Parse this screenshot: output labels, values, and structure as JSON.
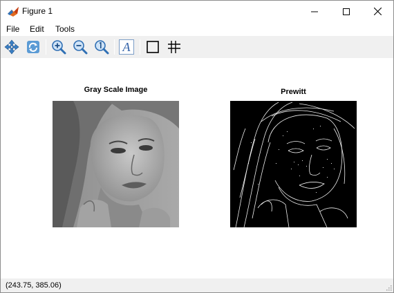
{
  "window": {
    "title": "Figure 1"
  },
  "menu": {
    "items": [
      "File",
      "Edit",
      "Tools"
    ]
  },
  "toolbar": {
    "tools": [
      "pan-icon",
      "rotate-icon",
      "zoom-in-icon",
      "zoom-out-icon",
      "zoom-reset-icon",
      "text-icon",
      "box-icon",
      "grid-icon"
    ]
  },
  "figure": {
    "left_title": "Gray Scale Image",
    "right_title": "Prewitt"
  },
  "status": {
    "coordinates": "(243.75, 385.06)"
  },
  "colors": {
    "toolbar_bg": "#f0f0f0",
    "statusbar_bg": "#f0f0f0",
    "edge_background": "#000000",
    "edge_lines": "#ffffff"
  }
}
